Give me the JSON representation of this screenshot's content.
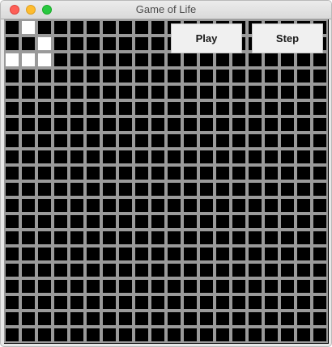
{
  "window": {
    "title": "Game of Life"
  },
  "controls": {
    "play_label": "Play",
    "step_label": "Step"
  },
  "board": {
    "rows": 20,
    "cols": 20,
    "cell_color": "#000000",
    "alive_color": "#ffffff",
    "grid_line_color": "#9a9a9a",
    "alive_cells": [
      [
        0,
        1
      ],
      [
        1,
        2
      ],
      [
        2,
        0
      ],
      [
        2,
        1
      ],
      [
        2,
        2
      ]
    ]
  }
}
